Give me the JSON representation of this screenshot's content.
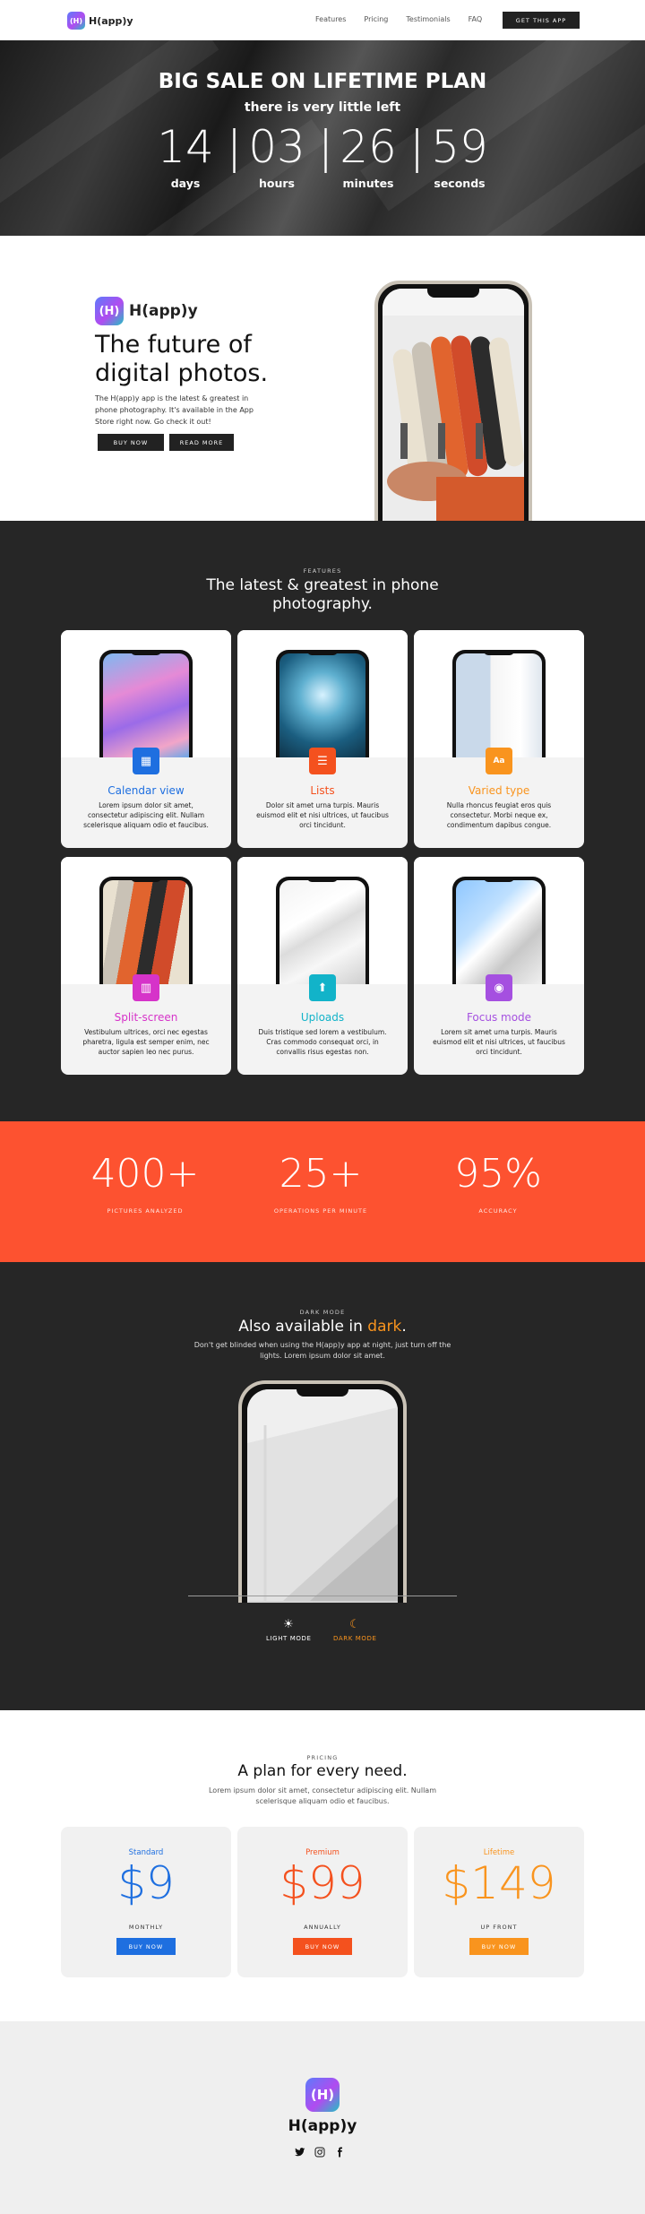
{
  "nav": {
    "brand": "H(app)y",
    "badge": "(H)",
    "links": [
      "Features",
      "Pricing",
      "Testimonials",
      "FAQ"
    ],
    "cta": "GET THIS APP"
  },
  "hero": {
    "title": "BIG SALE ON LIFETIME PLAN",
    "subtitle": "there is very little left",
    "countdown": [
      {
        "value": "14",
        "label": "days"
      },
      {
        "value": "03",
        "label": "hours"
      },
      {
        "value": "26",
        "label": "minutes"
      },
      {
        "value": "59",
        "label": "seconds"
      }
    ],
    "separator": "|"
  },
  "intro": {
    "brand": "H(app)y",
    "badge": "(H)",
    "heading": "The future of digital photos.",
    "body": "The H(app)y app is the latest & greatest in phone photography. It's available in the App Store right now. Go check it out!",
    "buy_label": "BUY NOW",
    "read_label": "READ MORE"
  },
  "features": {
    "eyebrow": "FEATURES",
    "heading": "The latest & greatest in phone photography.",
    "cards": [
      {
        "title": "Calendar view",
        "desc": "Lorem ipsum dolor sit amet, consectetur adipiscing elit. Nullam scelerisque aliquam odio et faucibus.",
        "color": "#1e6fe0",
        "icon": "calendar-icon",
        "glyph": "▦"
      },
      {
        "title": "Lists",
        "desc": "Dolor sit amet urna turpis. Mauris euismod elit et nisi ultrices, ut faucibus orci tincidunt.",
        "color": "#f4511e",
        "icon": "list-icon",
        "glyph": "☰"
      },
      {
        "title": "Varied type",
        "desc": "Nulla rhoncus feugiat eros quis consectetur. Morbi neque ex, condimentum dapibus congue.",
        "color": "#f9941e",
        "icon": "type-icon",
        "glyph": "Aa"
      },
      {
        "title": "Split-screen",
        "desc": "Vestibulum ultrices, orci nec egestas pharetra, ligula est semper enim, nec auctor sapien leo nec purus.",
        "color": "#d633c9",
        "icon": "split-screen-icon",
        "glyph": "▥"
      },
      {
        "title": "Uploads",
        "desc": "Duis tristique sed lorem a vestibulum. Cras commodo consequat orci, in convallis risus egestas non.",
        "color": "#12b3c9",
        "icon": "upload-icon",
        "glyph": "⬆"
      },
      {
        "title": "Focus mode",
        "desc": "Lorem sit amet urna turpis. Mauris euismod elit et nisi ultrices, ut faucibus orci tincidunt.",
        "color": "#a550e0",
        "icon": "eye-icon",
        "glyph": "◉"
      }
    ]
  },
  "stats": [
    {
      "value": "400+",
      "label": "PICTURES ANALYZED"
    },
    {
      "value": "25+",
      "label": "OPERATIONS PER MINUTE"
    },
    {
      "value": "95%",
      "label": "ACCURACY"
    }
  ],
  "darkmode": {
    "eyebrow": "DARK MODE",
    "heading_prefix": "Also available in ",
    "heading_accent": "dark",
    "heading_suffix": ".",
    "body": "Don't get blinded when using the H(app)y app at night, just turn off the lights. Lorem ipsum dolor sit amet.",
    "light_label": "LIGHT MODE",
    "dark_label": "DARK MODE",
    "accent_color": "#f9941e"
  },
  "pricing": {
    "eyebrow": "PRICING",
    "heading": "A plan for every need.",
    "body": "Lorem ipsum dolor sit amet, consectetur adipiscing elit. Nullam scelerisque aliquam odio et faucibus.",
    "plans": [
      {
        "name": "Standard",
        "price": "$9",
        "period": "MONTHLY",
        "button": "BUY NOW",
        "color": "#1e6fe0"
      },
      {
        "name": "Premium",
        "price": "$99",
        "period": "ANNUALLY",
        "button": "BUY NOW",
        "color": "#f4511e"
      },
      {
        "name": "Lifetime",
        "price": "$149",
        "period": "UP FRONT",
        "button": "BUY NOW",
        "color": "#f9941e"
      }
    ]
  },
  "footer": {
    "brand": "H(app)y",
    "badge": "(H)",
    "social": [
      "twitter-icon",
      "instagram-icon",
      "facebook-icon"
    ]
  }
}
